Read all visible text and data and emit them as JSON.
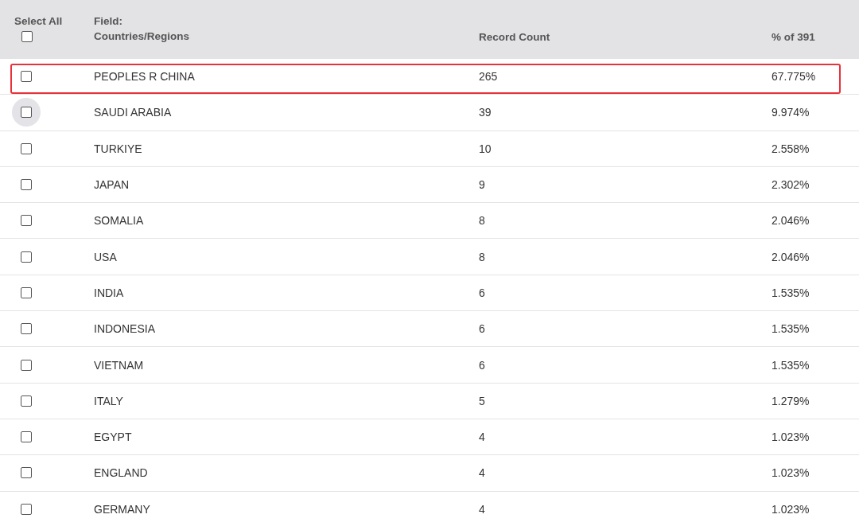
{
  "header": {
    "select_all": {
      "label": "Select All",
      "checked": false
    },
    "field_label": "Field:",
    "field_name": "Countries/Regions",
    "record_count": "Record Count",
    "percent": "% of 391"
  },
  "rows": [
    {
      "name": "PEOPLES R CHINA",
      "count": "265",
      "percent": "67.775%",
      "checked": false,
      "highlighted": true,
      "hovered": false
    },
    {
      "name": "SAUDI ARABIA",
      "count": "39",
      "percent": "9.974%",
      "checked": false,
      "highlighted": false,
      "hovered": true
    },
    {
      "name": "TURKIYE",
      "count": "10",
      "percent": "2.558%",
      "checked": false,
      "highlighted": false,
      "hovered": false
    },
    {
      "name": "JAPAN",
      "count": "9",
      "percent": "2.302%",
      "checked": false,
      "highlighted": false,
      "hovered": false
    },
    {
      "name": "SOMALIA",
      "count": "8",
      "percent": "2.046%",
      "checked": false,
      "highlighted": false,
      "hovered": false
    },
    {
      "name": "USA",
      "count": "8",
      "percent": "2.046%",
      "checked": false,
      "highlighted": false,
      "hovered": false
    },
    {
      "name": "INDIA",
      "count": "6",
      "percent": "1.535%",
      "checked": false,
      "highlighted": false,
      "hovered": false
    },
    {
      "name": "INDONESIA",
      "count": "6",
      "percent": "1.535%",
      "checked": false,
      "highlighted": false,
      "hovered": false
    },
    {
      "name": "VIETNAM",
      "count": "6",
      "percent": "1.535%",
      "checked": false,
      "highlighted": false,
      "hovered": false
    },
    {
      "name": "ITALY",
      "count": "5",
      "percent": "1.279%",
      "checked": false,
      "highlighted": false,
      "hovered": false
    },
    {
      "name": "EGYPT",
      "count": "4",
      "percent": "1.023%",
      "checked": false,
      "highlighted": false,
      "hovered": false
    },
    {
      "name": "ENGLAND",
      "count": "4",
      "percent": "1.023%",
      "checked": false,
      "highlighted": false,
      "hovered": false
    },
    {
      "name": "GERMANY",
      "count": "4",
      "percent": "1.023%",
      "checked": false,
      "highlighted": false,
      "hovered": false
    }
  ]
}
